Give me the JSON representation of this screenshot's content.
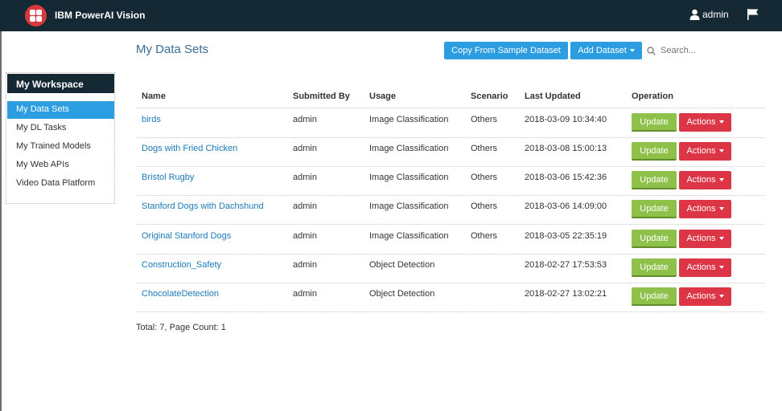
{
  "app": {
    "title": "IBM PowerAI Vision",
    "user": "admin",
    "user_icon": "user-icon",
    "flag_icon": "flag-icon"
  },
  "sidebar": {
    "heading": "My Workspace",
    "items": [
      {
        "label": "My Data Sets",
        "active": true
      },
      {
        "label": "My DL Tasks",
        "active": false
      },
      {
        "label": "My Trained Models",
        "active": false
      },
      {
        "label": "My Web APIs",
        "active": false
      },
      {
        "label": "Video Data Platform",
        "active": false
      }
    ]
  },
  "main": {
    "title": "My Data Sets",
    "copy_button": "Copy From Sample Dataset",
    "add_button": "Add Dataset",
    "search_placeholder": "Search...",
    "columns": [
      "Name",
      "Submitted By",
      "Usage",
      "Scenario",
      "Last Updated",
      "Operation"
    ],
    "rows": [
      {
        "name": "birds",
        "submitted_by": "admin",
        "usage": "Image Classification",
        "scenario": "Others",
        "last_updated": "2018-03-09 10:34:40"
      },
      {
        "name": "Dogs with Fried Chicken",
        "submitted_by": "admin",
        "usage": "Image Classification",
        "scenario": "Others",
        "last_updated": "2018-03-08 15:00:13"
      },
      {
        "name": "Bristol Rugby",
        "submitted_by": "admin",
        "usage": "Image Classification",
        "scenario": "Others",
        "last_updated": "2018-03-06 15:42:36"
      },
      {
        "name": "Stanford Dogs with Dachshund",
        "submitted_by": "admin",
        "usage": "Image Classification",
        "scenario": "Others",
        "last_updated": "2018-03-06 14:09:00"
      },
      {
        "name": "Original Stanford Dogs",
        "submitted_by": "admin",
        "usage": "Image Classification",
        "scenario": "Others",
        "last_updated": "2018-03-05 22:35:19"
      },
      {
        "name": "Construction_Safety",
        "submitted_by": "admin",
        "usage": "Object Detection",
        "scenario": "",
        "last_updated": "2018-02-27 17:53:53"
      },
      {
        "name": "ChocolateDetection",
        "submitted_by": "admin",
        "usage": "Object Detection",
        "scenario": "",
        "last_updated": "2018-02-27 13:02:21"
      }
    ],
    "update_label": "Update",
    "actions_label": "Actions",
    "footer": "Total: 7, Page Count: 1"
  },
  "colors": {
    "topbar": "#152935",
    "accent_blue": "#2b9de0",
    "update_green": "#8dc149",
    "actions_red": "#dc3545",
    "link": "#1c7ab8"
  }
}
